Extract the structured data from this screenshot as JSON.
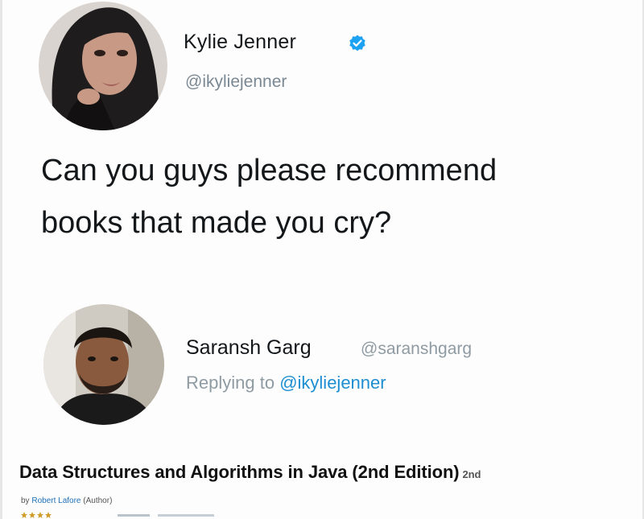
{
  "tweet": {
    "author_name": "Kylie Jenner",
    "author_handle": "@ikyliejenner",
    "verified_icon": "verified-badge-icon",
    "text_line1": "Can you guys please recommend",
    "text_line2": "books that made you cry?"
  },
  "reply": {
    "author_name": "Saransh Garg",
    "author_handle": "@saranshgarg",
    "replying_prefix": "Replying to",
    "replying_handle": "@ikyliejenner"
  },
  "book": {
    "title": "Data Structures and Algorithms in Java (2nd Edition)",
    "edition_suffix": "2nd",
    "by_prefix": "by",
    "author": "Robert Lafore",
    "author_role": "(Author)"
  },
  "colors": {
    "verified_blue": "#1da1f2",
    "link_blue": "#1d8ed1",
    "muted_gray": "#8f9ba3"
  }
}
